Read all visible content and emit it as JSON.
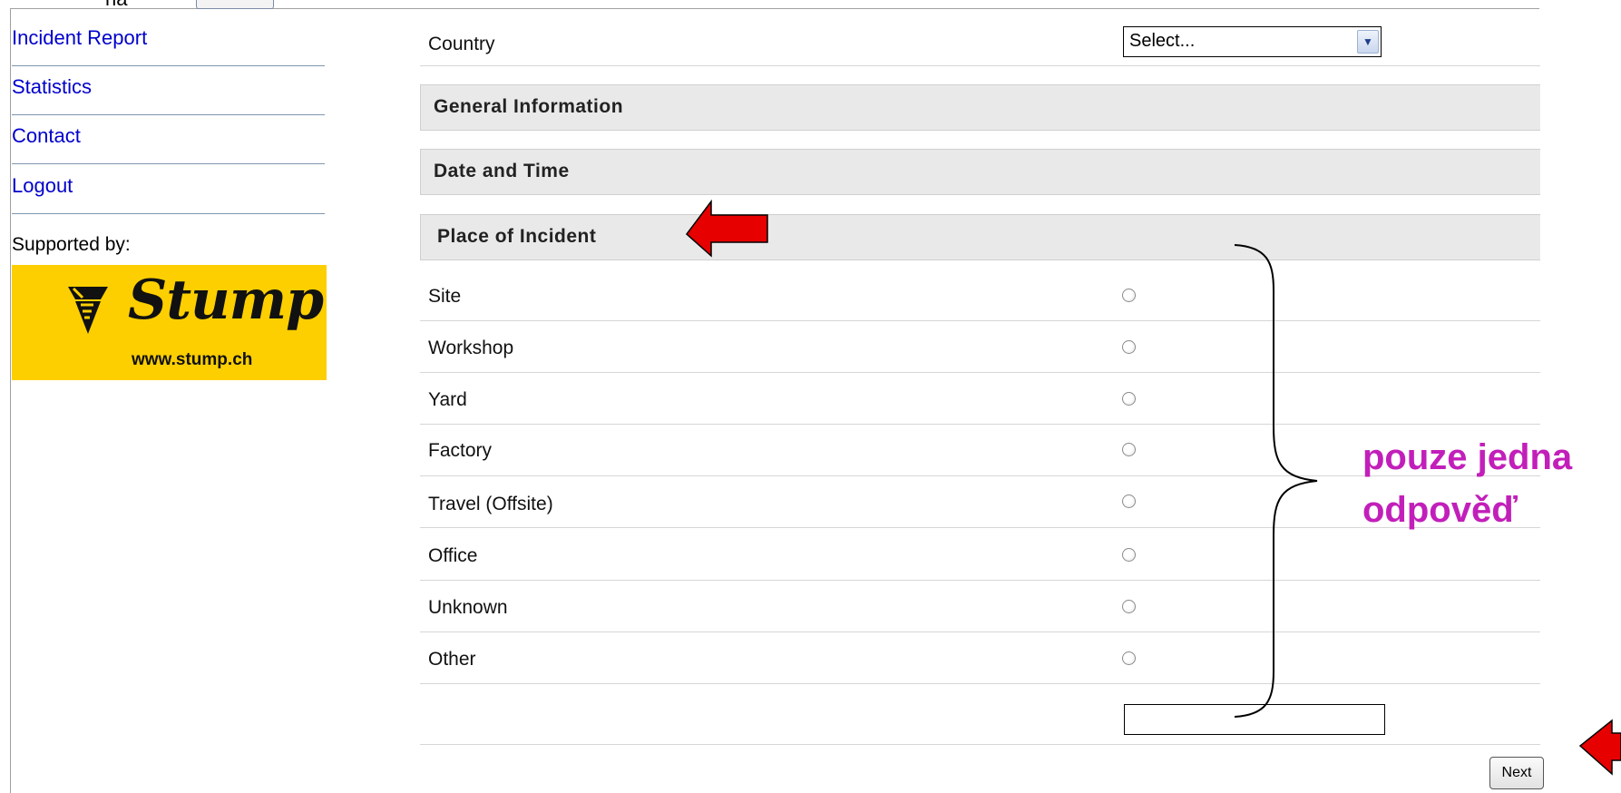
{
  "sidebar": {
    "links": [
      {
        "label": "Incident Report"
      },
      {
        "label": "Statistics"
      },
      {
        "label": "Contact"
      },
      {
        "label": "Logout"
      }
    ],
    "supported_by": "Supported by:",
    "sponsor": {
      "name": "Stump",
      "url": "www.stump.ch",
      "background": "#fdcf00"
    }
  },
  "top_fragment": "na",
  "form": {
    "country_label": "Country",
    "country_select_value": "Select...",
    "sections": [
      "General Information",
      "Date and Time",
      "Place of Incident"
    ],
    "place_options": [
      "Site",
      "Workshop",
      "Yard",
      "Factory",
      "Travel (Offsite)",
      "Office",
      "Unknown",
      "Other"
    ],
    "next_button": "Next"
  },
  "annotation": {
    "line1": "pouze jedna",
    "line2": "odpověď",
    "color": "#c21fba"
  },
  "arrows": {
    "color": "#e60000"
  }
}
